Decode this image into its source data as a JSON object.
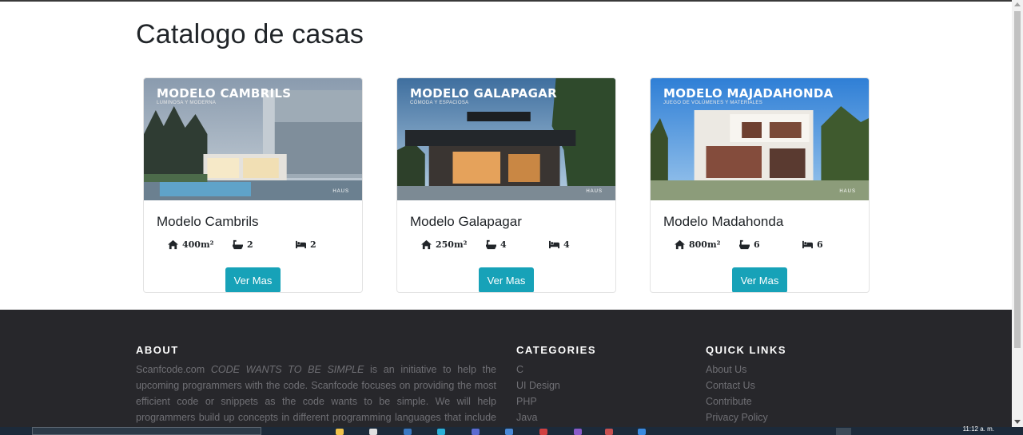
{
  "page": {
    "title": "Catalogo de casas"
  },
  "cards": [
    {
      "image_title": "MODELO CAMBRILS",
      "image_subtitle": "LUMINOSA Y MODERNA",
      "image_brand": "HAUS",
      "name": "Modelo Cambrils",
      "area": "400m²",
      "bathrooms": "2",
      "bedrooms": "2",
      "button_label": "Ver Mas"
    },
    {
      "image_title": "MODELO GALAPAGAR",
      "image_subtitle": "CÓMODA Y ESPACIOSA",
      "image_brand": "HAUS",
      "name": "Modelo Galapagar",
      "area": "250m²",
      "bathrooms": "4",
      "bedrooms": "4",
      "button_label": "Ver Mas"
    },
    {
      "image_title": "MODELO MAJADAHONDA",
      "image_subtitle": "JUEGO DE VOLÚMENES Y MATERIALES",
      "image_brand": "HAUS",
      "name": "Modelo Madahonda",
      "area": "800m²",
      "bathrooms": "6",
      "bedrooms": "6",
      "button_label": "Ver Mas"
    }
  ],
  "icons": {
    "area": "home-icon",
    "bathrooms": "bath-icon",
    "bedrooms": "bed-icon"
  },
  "footer": {
    "about": {
      "heading": "ABOUT",
      "site": "Scanfcode.com",
      "tagline": "CODE WANTS TO BE SIMPLE",
      "text": "is an initiative to help the upcoming programmers with the code. Scanfcode focuses on providing the most efficient code or snippets as the code wants to be simple. We will help programmers build up concepts in different programming languages that include C, C++, Java,"
    },
    "categories": {
      "heading": "CATEGORIES",
      "items": [
        "C",
        "UI Design",
        "PHP",
        "Java"
      ]
    },
    "quick_links": {
      "heading": "QUICK LINKS",
      "items": [
        "About Us",
        "Contact Us",
        "Contribute",
        "Privacy Policy"
      ]
    }
  },
  "taskbar": {
    "clock": "11:12 a. m."
  },
  "colors": {
    "accent": "#17a2b8",
    "footer_bg": "#27272b",
    "footer_text": "#6f6f74"
  }
}
